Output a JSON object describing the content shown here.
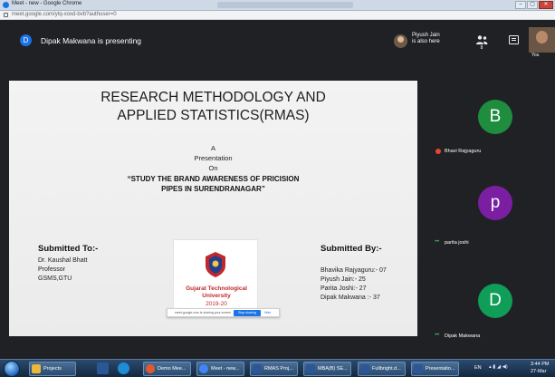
{
  "browser": {
    "window_title": "Meet - new - Google Chrome",
    "url": "meet.google.com/ytq-xoxd-bvb?authuser=0",
    "window_buttons": {
      "minimize": "–",
      "maximize": "▢",
      "close": "✕"
    }
  },
  "meet_header": {
    "presenter_initial": "D",
    "presenter_text": "Dipak Makwana is presenting",
    "also_here_name": "Piyush Jain",
    "also_here_sub": "is also here",
    "people_count": "8",
    "self_label": "You",
    "icons": [
      "people-icon",
      "chat-icon"
    ]
  },
  "slide": {
    "title_line1": "RESEARCH METHODOLOGY AND",
    "title_line2": "APPLIED STATISTICS(RMAS)",
    "a": "A",
    "presentation": "Presentation",
    "on": "On",
    "topic_line1": "“STUDY THE BRAND AWARENESS OF PRICISION",
    "topic_line2": "PIPES IN SURENDRANAGAR”",
    "submitted_to_heading": "Submitted To:-",
    "submitted_to": [
      "Dr. Kaushal Bhatt",
      "Professor",
      "GSMS,GTU"
    ],
    "submitted_by_heading": "Submitted By:-",
    "submitted_by": [
      "Bhavika Rajyaguru:- 07",
      "Piyush Jain:- 25",
      "Parita Joshi:- 27",
      "Dipak Makwana :- 37"
    ],
    "logo": {
      "name_line1": "Gujarat Technological",
      "name_line2": "University",
      "year": "2019-20"
    }
  },
  "share_banner": {
    "message": "meet.google.com is sharing your screen",
    "stop_button": "Stop sharing",
    "hide_button": "Hide"
  },
  "participants": [
    {
      "initial": "B",
      "name": "Bhavi Rajyaguru",
      "color": "#1e8e3e",
      "muted": true
    },
    {
      "initial": "p",
      "name": "parita joshi",
      "color": "#7b1fa2",
      "muted": false
    },
    {
      "initial": "D",
      "name": "Dipak Makwana",
      "color": "#0f9d58",
      "muted": false
    }
  ],
  "taskbar": {
    "buttons": [
      {
        "label": "Projects",
        "color": "#e8b93a"
      },
      {
        "label": "Demo Mee...",
        "color": "#e3592d"
      },
      {
        "label": "Meet - new...",
        "color": "#4285f4"
      },
      {
        "label": "RMAS Proj...",
        "color": "#2b5797"
      },
      {
        "label": "MBA(B) SE...",
        "color": "#2b5797"
      },
      {
        "label": "Fullbright.d...",
        "color": "#2b5797"
      },
      {
        "label": "Presentatio...",
        "color": "#2b5797"
      }
    ],
    "lang": "EN",
    "time": "3:44 PM",
    "date": "27-Mar"
  }
}
